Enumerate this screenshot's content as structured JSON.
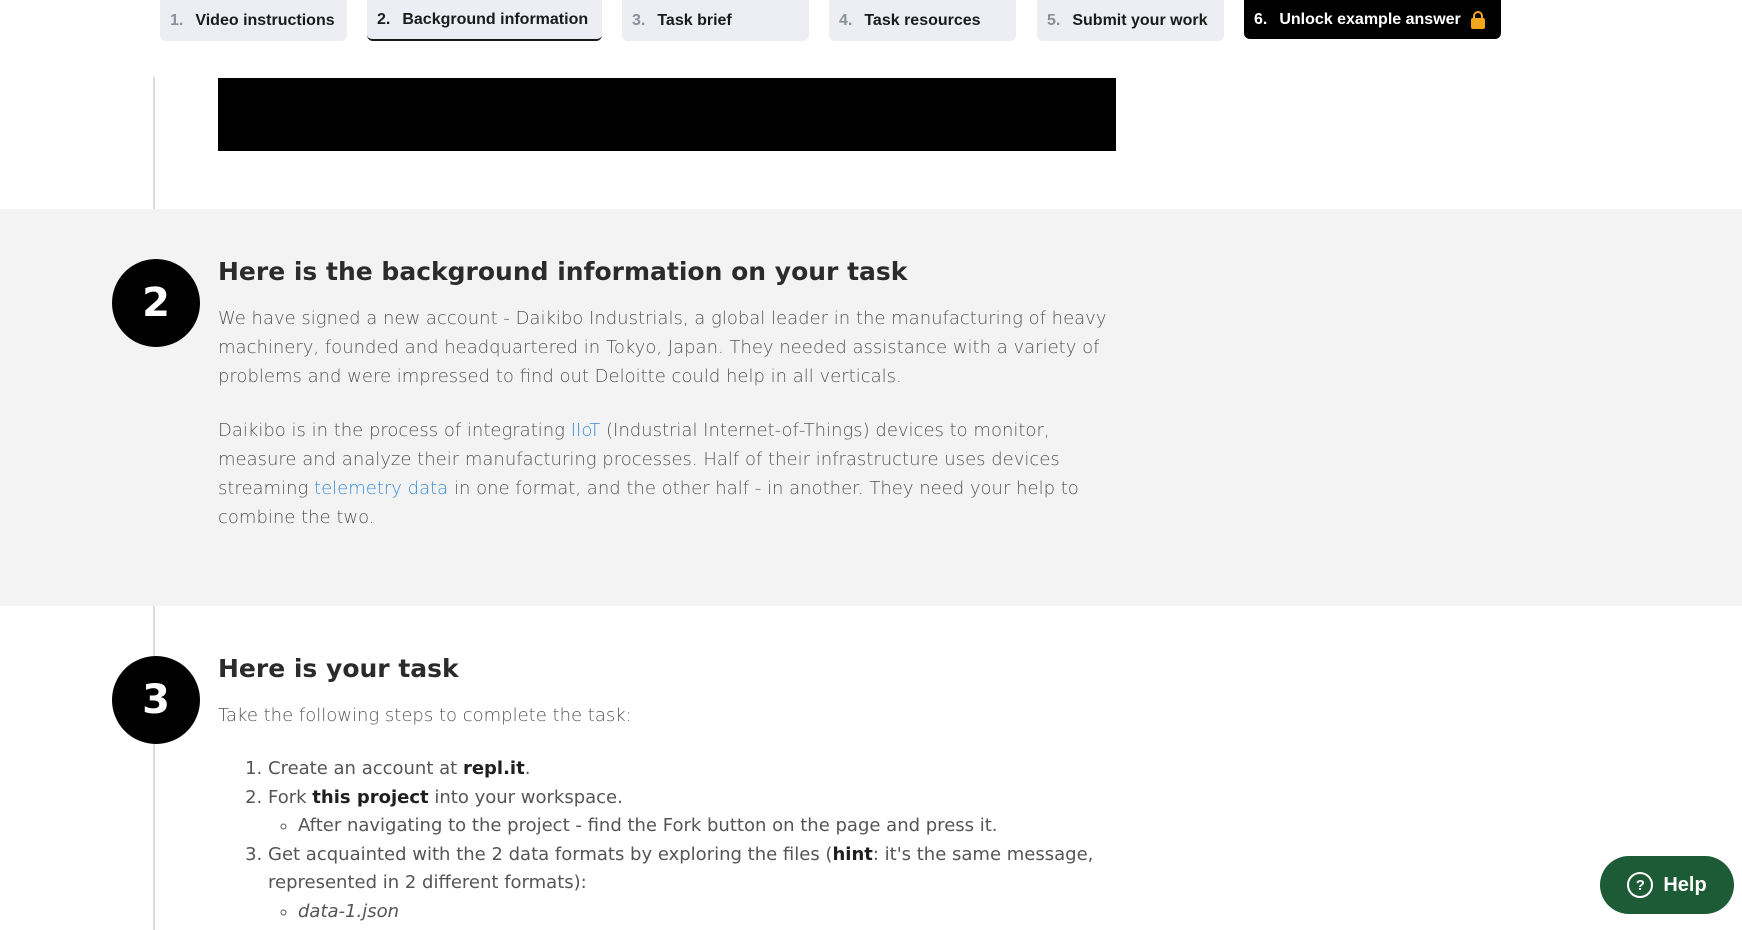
{
  "tabs": [
    {
      "num": "1.",
      "label": "Video instructions"
    },
    {
      "num": "2.",
      "label": "Background information"
    },
    {
      "num": "3.",
      "label": "Task brief"
    },
    {
      "num": "4.",
      "label": "Task resources"
    },
    {
      "num": "5.",
      "label": "Submit your work"
    },
    {
      "num": "6.",
      "label": "Unlock example answer"
    }
  ],
  "background": {
    "step": "2",
    "title": "Here is the background information on your task",
    "p1": "We have signed a new account - Daikibo Industrials, a global leader in the manufacturing of heavy machinery, founded and headquartered in Tokyo, Japan. They needed assistance with a variety of problems and were impressed to find out Deloitte could help in all verticals.",
    "p2_a": "Daikibo is in the process of integrating ",
    "p2_link1": "IIoT",
    "p2_b": " (Industrial Internet-of-Things) devices to monitor, measure and analyze their manufacturing processes. Half of their infrastructure uses devices streaming ",
    "p2_link2": "telemetry data",
    "p2_c": " in one format, and the other half - in another. They need your help to combine the two."
  },
  "task": {
    "step": "3",
    "title": "Here is your task",
    "intro": "Take the following steps to complete the task:",
    "step1_a": "Create an account at ",
    "step1_b": "repl.it",
    "step1_c": ".",
    "step2_a": "Fork ",
    "step2_b": "this project",
    "step2_c": " into your workspace.",
    "step2_sub": "After navigating to the project - find the Fork button on the page and press it.",
    "step3_a": "Get acquainted with the 2 data formats by exploring the files (",
    "step3_b": "hint",
    "step3_c": ": it's the same message, represented in 2 different formats):",
    "step3_sub": "data-1.json"
  },
  "help": {
    "label": "Help",
    "icon": "question-circle-icon"
  },
  "colors": {
    "accent_link": "#3b8ed8",
    "help_bg": "#1d5a36",
    "lock": "#f3a51c"
  }
}
